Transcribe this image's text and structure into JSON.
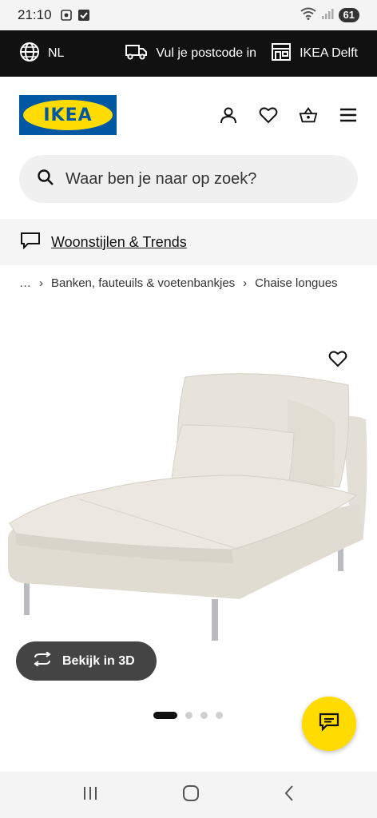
{
  "status_bar": {
    "time": "21:10",
    "battery": "61"
  },
  "top_bar": {
    "language": "NL",
    "postcode_label": "Vul je postcode in",
    "store_label": "IKEA Delft"
  },
  "header": {
    "logo_text": "IKEA"
  },
  "search": {
    "placeholder": "Waar ben je naar op zoek?"
  },
  "banner": {
    "link_label": "Woonstijlen & Trends"
  },
  "breadcrumb": {
    "ellipsis": "…",
    "items": [
      "Banken, fauteuils & voetenbankjes",
      "Chaise longues"
    ]
  },
  "product": {
    "view_3d_label": "Bekijk in 3D"
  },
  "carousel": {
    "total": 4,
    "active_index": 0
  },
  "colors": {
    "ikea_blue": "#0058a3",
    "ikea_yellow": "#ffdb00",
    "top_bar": "#111111"
  }
}
